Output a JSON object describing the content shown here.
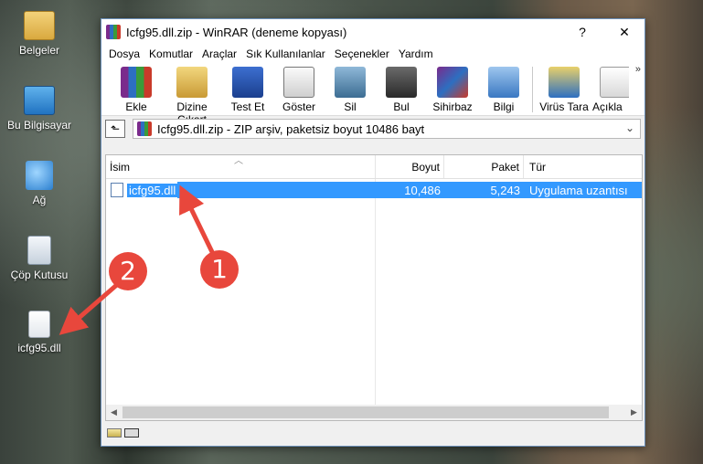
{
  "desktop": {
    "icons": [
      {
        "label": "Belgeler",
        "icon": "folder-icon"
      },
      {
        "label": "Bu Bilgisayar",
        "icon": "computer-icon"
      },
      {
        "label": "Ağ",
        "icon": "network-icon"
      },
      {
        "label": "Çöp Kutusu",
        "icon": "recycle-bin-icon"
      },
      {
        "label": "icfg95.dll",
        "icon": "dll-file-icon"
      }
    ]
  },
  "window": {
    "title": "Icfg95.dll.zip - WinRAR (deneme kopyası)",
    "help_label": "?",
    "close_label": "✕"
  },
  "menu": [
    "Dosya",
    "Komutlar",
    "Araçlar",
    "Sık Kullanılanlar",
    "Seçenekler",
    "Yardım"
  ],
  "toolbar": {
    "items": [
      "Ekle",
      "Dizine Çıkart",
      "Test Et",
      "Göster",
      "Sil",
      "Bul",
      "Sihirbaz",
      "Bilgi",
      "Virüs Tara",
      "Açıkla"
    ],
    "more_label": "»"
  },
  "pathbar": {
    "up_label": "⬑",
    "text": "Icfg95.dll.zip - ZIP arşiv, paketsiz boyut 10486 bayt",
    "caret": "⌄"
  },
  "filelist": {
    "columns": {
      "name": "İsim",
      "size": "Boyut",
      "packed": "Paket",
      "type": "Tür"
    },
    "rows": [
      {
        "name": "icfg95.dll",
        "size": "10,486",
        "packed": "5,243",
        "type": "Uygulama uzantısı"
      }
    ]
  },
  "callouts": [
    "1",
    "2"
  ],
  "colors": {
    "selection": "#3399ff",
    "callout": "#e8473c"
  }
}
